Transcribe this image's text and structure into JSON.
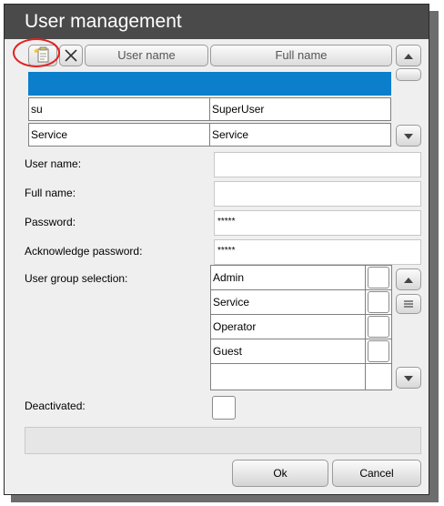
{
  "dialog": {
    "title": "User management"
  },
  "toolbar": {
    "new_icon": "new-document-icon",
    "delete_icon": "close-x-icon"
  },
  "table": {
    "columns": [
      "User name",
      "Full name"
    ],
    "rows": [
      {
        "user_name": "",
        "full_name": "",
        "selected": true
      },
      {
        "user_name": "su",
        "full_name": "SuperUser",
        "selected": false
      },
      {
        "user_name": "Service",
        "full_name": "Service",
        "selected": false
      }
    ]
  },
  "form": {
    "user_name_label": "User name:",
    "user_name_value": "",
    "full_name_label": "Full name:",
    "full_name_value": "",
    "password_label": "Password:",
    "password_value": "*****",
    "ack_password_label": "Acknowledge password:",
    "ack_password_value": "*****",
    "group_label": "User group selection:",
    "groups": [
      "Admin",
      "Service",
      "Operator",
      "Guest",
      ""
    ],
    "deactivated_label": "Deactivated:"
  },
  "buttons": {
    "ok": "Ok",
    "cancel": "Cancel"
  },
  "colors": {
    "titlebar": "#4a4a4a",
    "selection": "#0b7fcb",
    "annotation": "#e02222"
  }
}
